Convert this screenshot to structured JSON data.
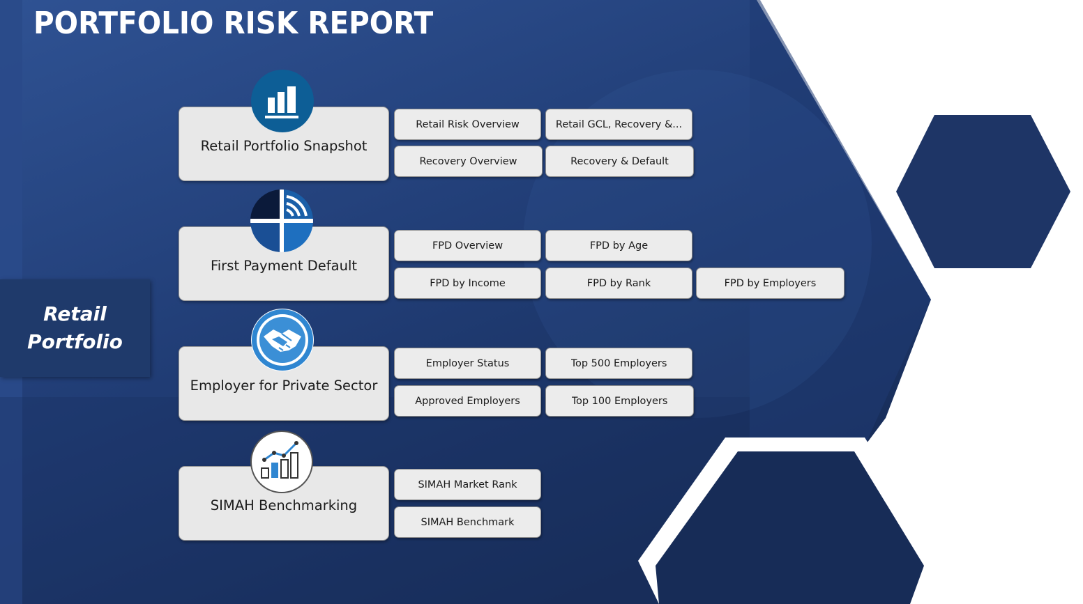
{
  "title": "PORTFOLIO RISK REPORT",
  "side_label": "Retail\nPortfolio",
  "sections": [
    {
      "label": "Retail Portfolio Snapshot",
      "icon": "bar-chart-icon",
      "buttons": [
        "Retail Risk Overview",
        "Retail GCL, Recovery &...",
        "Recovery Overview",
        "Recovery & Default"
      ]
    },
    {
      "label": "First Payment Default",
      "icon": "radar-crosshair-icon",
      "buttons": [
        "FPD Overview",
        "FPD by Age",
        "FPD by Income",
        "FPD by Rank",
        "FPD by Employers"
      ]
    },
    {
      "label": "Employer for Private Sector",
      "icon": "handshake-icon",
      "buttons": [
        "Employer Status",
        "Top 500 Employers",
        "Approved Employers",
        "Top 100 Employers"
      ]
    },
    {
      "label": "SIMAH Benchmarking",
      "icon": "growth-chart-icon",
      "buttons": [
        "SIMAH Market Rank",
        "SIMAH Benchmark"
      ]
    }
  ],
  "colors": {
    "background_dark": "#1c3260",
    "background_mid": "#2c4b8a",
    "card": "#e8e8e8",
    "icon_blue": "#1b5e9b",
    "white": "#ffffff"
  }
}
